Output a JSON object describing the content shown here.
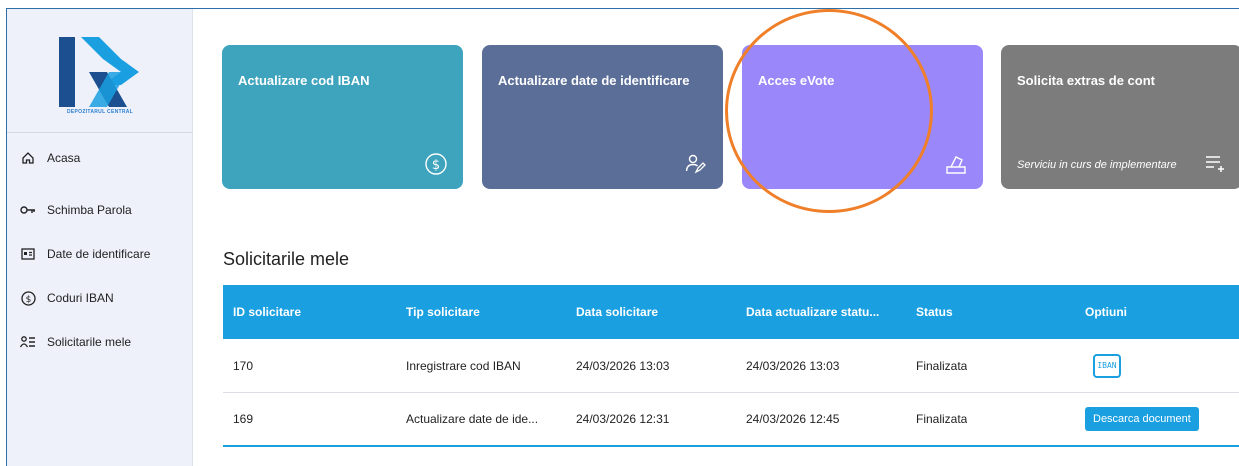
{
  "brand": {
    "logo_text": "DEPOZITARUL CENTRAL",
    "primary": "#1a9fe0",
    "logo_dark": "#1b4f8f"
  },
  "sidebar": {
    "items": [
      {
        "label": "Acasa",
        "icon": "home-icon"
      },
      {
        "label": "Schimba Parola",
        "icon": "key-icon"
      },
      {
        "label": "Date de identificare",
        "icon": "id-card-icon"
      },
      {
        "label": "Coduri IBAN",
        "icon": "dollar-circle-icon"
      },
      {
        "label": "Solicitarile mele",
        "icon": "user-list-icon"
      }
    ]
  },
  "cards": [
    {
      "title": "Actualizare cod IBAN",
      "icon": "dollar-circle-icon",
      "color": "#3ea3bd",
      "note": ""
    },
    {
      "title": "Actualizare date de identificare",
      "icon": "user-edit-icon",
      "color": "#5b6e98",
      "note": ""
    },
    {
      "title": "Acces eVote",
      "icon": "ballot-box-icon",
      "color": "#9a87f9",
      "note": ""
    },
    {
      "title": "Solicita extras de cont",
      "icon": "list-add-icon",
      "color": "#7c7c7c",
      "note": "Serviciu in curs de implementare"
    }
  ],
  "requests": {
    "title": "Solicitarile mele",
    "columns": [
      "ID solicitare",
      "Tip solicitare",
      "Data solicitare",
      "Data actualizare statu...",
      "Status",
      "Optiuni"
    ],
    "rows": [
      {
        "id": "170",
        "type": "Inregistrare cod IBAN",
        "date": "24/03/2026 13:03",
        "updated": "24/03/2026 13:03",
        "status": "Finalizata",
        "option": "IBAN"
      },
      {
        "id": "169",
        "type": "Actualizare date de ide...",
        "date": "24/03/2026 12:31",
        "updated": "24/03/2026 12:45",
        "status": "Finalizata",
        "option": "Descarca document"
      }
    ]
  }
}
